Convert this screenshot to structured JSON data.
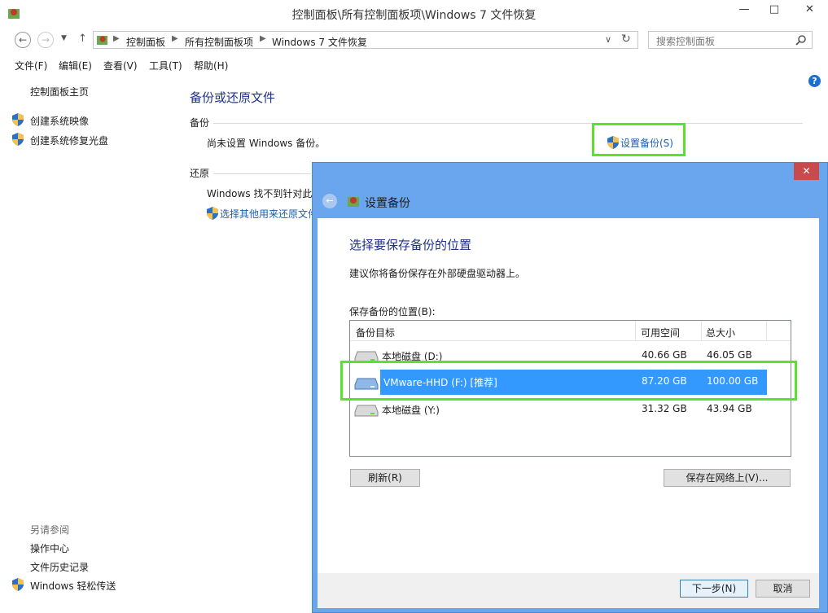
{
  "window": {
    "title": "控制面板\\所有控制面板项\\Windows 7 文件恢复",
    "minimize": "—",
    "maximize": "□",
    "close": "✕"
  },
  "address": {
    "crumbs": [
      "控制面板",
      "所有控制面板项",
      "Windows 7 文件恢复"
    ],
    "search_placeholder": "搜索控制面板"
  },
  "menu": [
    "文件(F)",
    "编辑(E)",
    "查看(V)",
    "工具(T)",
    "帮助(H)"
  ],
  "left_nav": {
    "home": "控制面板主页",
    "create_image": "创建系统映像",
    "create_repair_disc": "创建系统修复光盘",
    "see_also": "另请参阅",
    "see_also_items": [
      "操作中心",
      "文件历史记录",
      "Windows 轻松传送"
    ]
  },
  "main": {
    "title": "备份或还原文件",
    "backup_label": "备份",
    "backup_status": "尚未设置 Windows 备份。",
    "setup_backup_link": "设置备份(S)",
    "restore_label": "还原",
    "restore_status": "Windows 找不到针对此",
    "restore_other_link": "选择其他用来还原文件"
  },
  "dialog": {
    "title": "设置备份",
    "heading": "选择要保存备份的位置",
    "description": "建议你将备份保存在外部硬盘驱动器上。",
    "list_label": "保存备份的位置(B):",
    "columns": [
      "备份目标",
      "可用空间",
      "总大小"
    ],
    "rows": [
      {
        "name": "本地磁盘 (D:)",
        "free": "40.66 GB",
        "total": "46.05 GB",
        "selected": false
      },
      {
        "name": "VMware-HHD (F:) [推荐]",
        "free": "87.20 GB",
        "total": "100.00 GB",
        "selected": true
      },
      {
        "name": "本地磁盘 (Y:)",
        "free": "31.32 GB",
        "total": "43.94 GB",
        "selected": false
      }
    ],
    "refresh_button": "刷新(R)",
    "save_network_button": "保存在网络上(V)...",
    "next_button": "下一步(N)",
    "cancel_button": "取消",
    "close": "✕"
  },
  "colors": {
    "highlight": "#5be22f",
    "selection": "#3399ff",
    "dialog_frame": "#6aa6ee",
    "link": "#1a5fb4"
  }
}
